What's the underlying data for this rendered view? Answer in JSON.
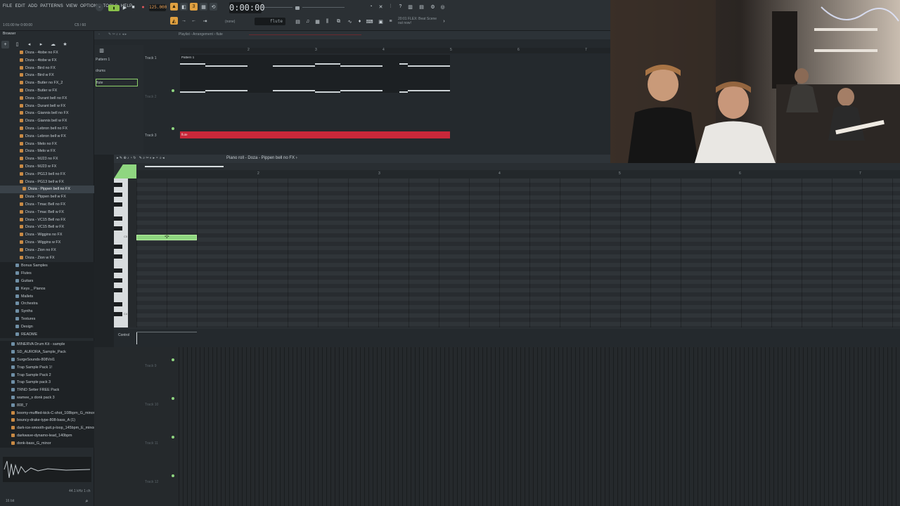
{
  "menu": [
    "FILE",
    "EDIT",
    "ADD",
    "PATTERNS",
    "VIEW",
    "OPTIONS",
    "TOOLS",
    "HELP"
  ],
  "toolbar": {
    "tempo": "125.000",
    "time": "0:00:00",
    "hint_left": "1:01:00 for 0:00:00",
    "hint_right": "C5 / 60",
    "pattern_select": "flute",
    "news": "20:01 FLEX: Beat Scene out now!",
    "mode": "(none)"
  },
  "browser": {
    "title": "Browser",
    "files": [
      "Doza - 4tobe no FX",
      "Doza - 4tobe w FX",
      "Doza - Bird no FX",
      "Doza - Bird w FX",
      "Doza - Butler no FX_2",
      "Doza - Butler w FX",
      "Doza - Durant bell no FX",
      "Doza - Durant bell w FX",
      "Doza - Giannis bell no FX",
      "Doza - Giannis bell w FX",
      "Doza - Lebron bell no FX",
      "Doza - Lebron bell w FX",
      "Doza - Melo no FX",
      "Doza - Melo w FX",
      "Doza - MJ23 no FX",
      "Doza - MJ23 w FX",
      "Doza - PG13 bell no FX",
      "Doza - PG13 bell w FX",
      "Doza - Pippen bell no FX",
      "Doza - Pippen bell w FX",
      "Doza - Tmac Bell no FX",
      "Doza - Tmac Bell w FX",
      "Doza - VC15 Bell no FX",
      "Doza - VC15 Bell w FX",
      "Doza - Wiggins no FX",
      "Doza - Wiggins w FX",
      "Doza - Zion no FX",
      "Doza - Zion w FX"
    ],
    "selected_index": 18,
    "folders": [
      "Bonus Samples",
      "Flutes",
      "Guitars",
      "Keys _ Pianos",
      "Mallets",
      "Orchestra",
      "Synths",
      "Textures",
      "Design",
      "README"
    ],
    "packs": [
      "MINERVA Drum Kit - sample",
      "SD_AURORA_Sample_Pack",
      "SurgeSounds-808Vol1",
      "Trap Sample Pack 1!",
      "Trap Sample Pack 2",
      "Trap Sample pack 3",
      "TRND Setter FREE Pack",
      "wamee_s donk pack 3",
      "808_7"
    ],
    "samples": [
      "boomy-muffled-kick-C-shot_108bpm_G_minor",
      "bouncy-drake-type-808-bass_A (1)",
      "dark-ice-smooth-guit.p-loop_145bpm_E_minor",
      "darkwave-dynamo-lead_140bpm",
      "donk-bass_G_minor"
    ],
    "footer_left": "16 bit",
    "footer_right": "44.1 kHz 1 ch"
  },
  "playlist": {
    "title": "Playlist - Arrangement › flute",
    "patterns": [
      "Pattern 1",
      "drums",
      "flute"
    ],
    "selected_pattern": 2,
    "tracks": [
      "Track 1",
      "Track 2",
      "Track 3"
    ],
    "clip_labels": [
      "Pattern 1",
      "flute"
    ],
    "lower_tracks": [
      "Track 9",
      "Track 10",
      "Track 11",
      "Track 12"
    ],
    "ruler": [
      "2",
      "3",
      "4",
      "5",
      "6",
      "7"
    ]
  },
  "pianoroll": {
    "title": "Piano roll - Doza - Pippen bell no FX ›",
    "ruler": [
      "2",
      "3",
      "4",
      "5",
      "6",
      "7"
    ],
    "key_labels": [
      "C5",
      "C4"
    ],
    "control_label": "Control"
  },
  "colors": {
    "accent_green": "#8fd680",
    "clip_red": "#c8283a",
    "toolbar_orange": "#e0a040"
  }
}
